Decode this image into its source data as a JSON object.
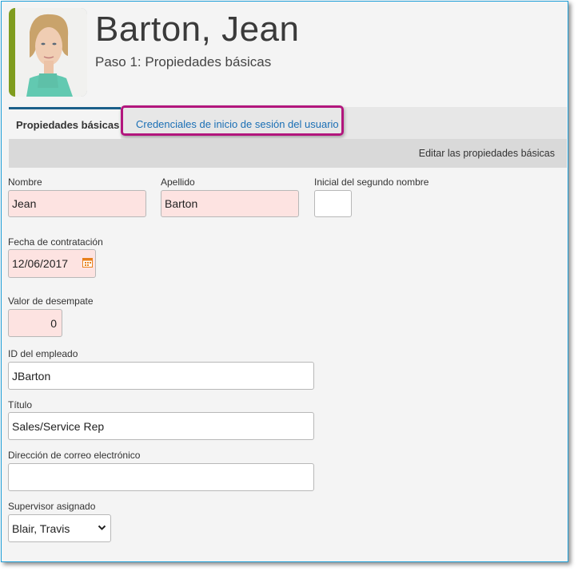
{
  "header": {
    "name": "Barton, Jean",
    "step": "Paso 1: Propiedades básicas"
  },
  "tabs": {
    "active": "Propiedades básicas",
    "credentials": "Credenciales de inicio de sesión del usuario"
  },
  "subbar": {
    "edit_label": "Editar las propiedades básicas"
  },
  "form": {
    "first_name": {
      "label": "Nombre",
      "value": "Jean"
    },
    "last_name": {
      "label": "Apellido",
      "value": "Barton"
    },
    "middle_initial": {
      "label": "Inicial del segundo nombre",
      "value": ""
    },
    "hire_date": {
      "label": "Fecha de contratación",
      "value": "12/06/2017"
    },
    "tiebreak": {
      "label": "Valor de desempate",
      "value": "0"
    },
    "employee_id": {
      "label": "ID del empleado",
      "value": "JBarton"
    },
    "title": {
      "label": "Título",
      "value": "Sales/Service Rep"
    },
    "email": {
      "label": "Dirección de correo electrónico",
      "value": ""
    },
    "supervisor": {
      "label": "Supervisor asignado",
      "value": "Blair, Travis"
    }
  },
  "colors": {
    "accent_link": "#1a6fb5",
    "highlight": "#b2167d",
    "required_bg": "#fde3e1",
    "active_tab_border": "#1b5f8a"
  }
}
